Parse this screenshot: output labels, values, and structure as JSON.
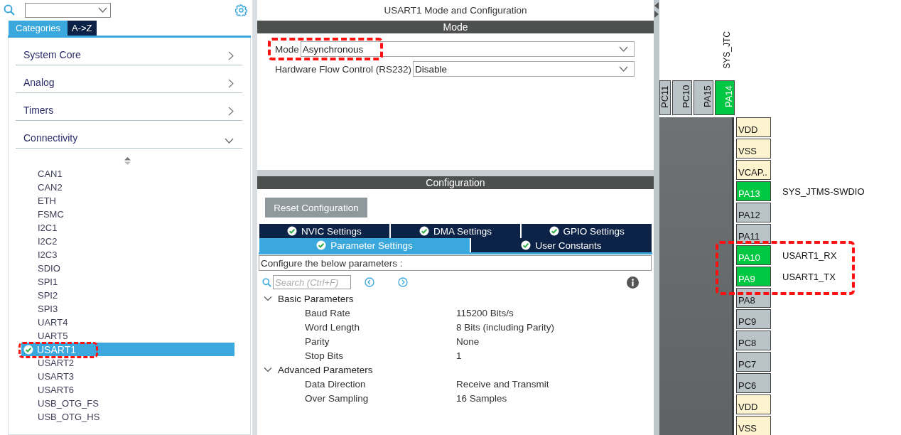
{
  "left_panel": {
    "tabs": [
      {
        "label": "Categories",
        "selected": true
      },
      {
        "label": "A->Z",
        "selected": false
      }
    ],
    "categories": [
      {
        "label": "System Core",
        "expanded": false
      },
      {
        "label": "Analog",
        "expanded": false
      },
      {
        "label": "Timers",
        "expanded": false
      },
      {
        "label": "Connectivity",
        "expanded": true,
        "children": [
          {
            "label": "CAN1",
            "selected": false,
            "configured": false
          },
          {
            "label": "CAN2",
            "selected": false,
            "configured": false
          },
          {
            "label": "ETH",
            "selected": false,
            "configured": false
          },
          {
            "label": "FSMC",
            "selected": false,
            "configured": false
          },
          {
            "label": "I2C1",
            "selected": false,
            "configured": false
          },
          {
            "label": "I2C2",
            "selected": false,
            "configured": false
          },
          {
            "label": "I2C3",
            "selected": false,
            "configured": false
          },
          {
            "label": "SDIO",
            "selected": false,
            "configured": false
          },
          {
            "label": "SPI1",
            "selected": false,
            "configured": false
          },
          {
            "label": "SPI2",
            "selected": false,
            "configured": false
          },
          {
            "label": "SPI3",
            "selected": false,
            "configured": false
          },
          {
            "label": "UART4",
            "selected": false,
            "configured": false
          },
          {
            "label": "UART5",
            "selected": false,
            "configured": false
          },
          {
            "label": "USART1",
            "selected": true,
            "configured": true
          },
          {
            "label": "USART2",
            "selected": false,
            "configured": false
          },
          {
            "label": "USART3",
            "selected": false,
            "configured": false
          },
          {
            "label": "USART6",
            "selected": false,
            "configured": false
          },
          {
            "label": "USB_OTG_FS",
            "selected": false,
            "configured": false
          },
          {
            "label": "USB_OTG_HS",
            "selected": false,
            "configured": false
          }
        ]
      }
    ]
  },
  "config_panel": {
    "title": "USART1 Mode and Configuration",
    "mode_section": {
      "header": "Mode",
      "fields": [
        {
          "label": "Mode",
          "value": "Asynchronous"
        },
        {
          "label": "Hardware Flow Control (RS232)",
          "value": "Disable"
        }
      ]
    },
    "configuration_section": {
      "header": "Configuration",
      "reset_button": "Reset Configuration",
      "tab_rows": [
        [
          {
            "label": "NVIC Settings",
            "selected": false,
            "checked": true
          },
          {
            "label": "DMA Settings",
            "selected": false,
            "checked": true
          },
          {
            "label": "GPIO Settings",
            "selected": false,
            "checked": true
          }
        ],
        [
          {
            "label": "Parameter Settings",
            "selected": true,
            "checked": true
          },
          {
            "label": "User Constants",
            "selected": false,
            "checked": true
          }
        ]
      ],
      "description": "Configure the below parameters :",
      "search": {
        "placeholder": "Search (Ctrl+F)"
      },
      "groups": [
        {
          "label": "Basic Parameters",
          "expanded": true,
          "children": [
            {
              "name": "Baud Rate",
              "value": "115200 Bits/s"
            },
            {
              "name": "Word Length",
              "value": "8 Bits (including Parity)"
            },
            {
              "name": "Parity",
              "value": "None"
            },
            {
              "name": "Stop Bits",
              "value": "1"
            }
          ]
        },
        {
          "label": "Advanced Parameters",
          "expanded": true,
          "children": [
            {
              "name": "Data Direction",
              "value": "Receive and Transmit"
            },
            {
              "name": "Over Sampling",
              "value": "16 Samples"
            }
          ]
        }
      ]
    }
  },
  "pinout": {
    "top_pins": [
      {
        "label": "PC11",
        "kind": "io"
      },
      {
        "label": "PC10",
        "kind": "io"
      },
      {
        "label": "PA15",
        "kind": "io"
      },
      {
        "label": "PA14",
        "kind": "active",
        "signal": "SYS_JTC"
      }
    ],
    "side_pins": [
      {
        "label": "VDD",
        "kind": "power"
      },
      {
        "label": "VSS",
        "kind": "power"
      },
      {
        "label": "VCAP..",
        "kind": "power"
      },
      {
        "label": "PA13",
        "kind": "active",
        "signal": "SYS_JTMS-SWDIO"
      },
      {
        "label": "PA12",
        "kind": "io"
      },
      {
        "label": "PA11",
        "kind": "io"
      },
      {
        "label": "PA10",
        "kind": "active",
        "signal": "USART1_RX"
      },
      {
        "label": "PA9",
        "kind": "active",
        "signal": "USART1_TX"
      },
      {
        "label": "PA8",
        "kind": "io"
      },
      {
        "label": "PC9",
        "kind": "io"
      },
      {
        "label": "PC8",
        "kind": "io"
      },
      {
        "label": "PC7",
        "kind": "io"
      },
      {
        "label": "PC6",
        "kind": "io"
      },
      {
        "label": "VDD",
        "kind": "power"
      },
      {
        "label": "VSS",
        "kind": "power"
      }
    ]
  }
}
